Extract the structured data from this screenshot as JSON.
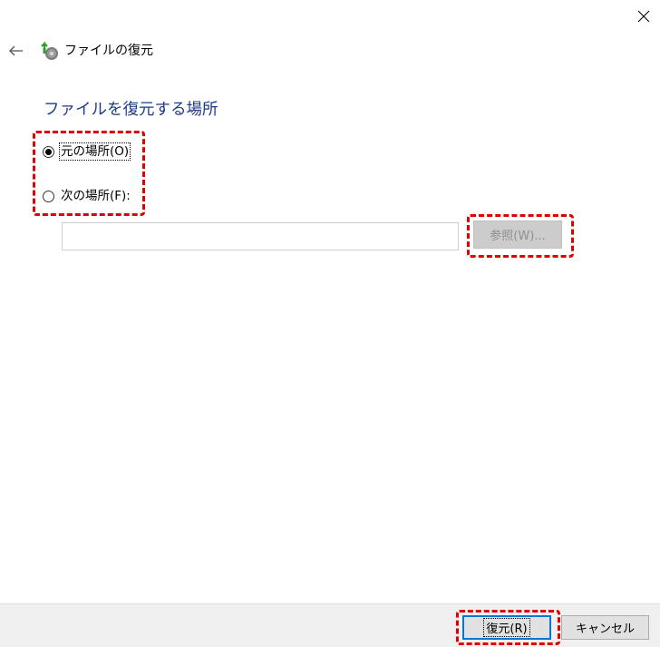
{
  "window": {
    "close_icon": "close-icon",
    "back_icon": "back-arrow-icon"
  },
  "header": {
    "app_icon": "file-restore-icon",
    "title": "ファイルの復元"
  },
  "main": {
    "heading": "ファイルを復元する場所",
    "options": [
      {
        "label": "元の場所(O)",
        "selected": true
      },
      {
        "label": "次の場所(F):",
        "selected": false
      }
    ],
    "path_input": {
      "value": "",
      "placeholder": ""
    },
    "browse_label": "参照(W)..."
  },
  "footer": {
    "restore_label": "復元(R)",
    "cancel_label": "キャンセル"
  },
  "colors": {
    "heading": "#1f3b88",
    "annotation": "#e00000",
    "focus": "#0078d7"
  }
}
